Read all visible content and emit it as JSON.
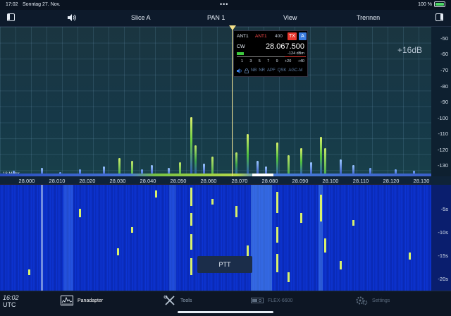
{
  "status_bar": {
    "time": "17:02",
    "date": "Sonntag 27. Nov.",
    "dots": "•••",
    "battery_percent": "100 %",
    "battery_level": 1.0
  },
  "nav": {
    "left_toggle_icon": "sidebar-left-icon",
    "speaker_icon": "speaker-icon",
    "slice": "Slice A",
    "pan": "PAN 1",
    "view": "View",
    "disconnect": "Trennen",
    "right_toggle_icon": "sidebar-right-icon"
  },
  "spectrum": {
    "db_ticks": [
      "-50",
      "-60",
      "-70",
      "-80",
      "-90",
      "-100",
      "-110",
      "-120",
      "-130"
    ],
    "offset_label": "+16dB",
    "band_label": "18 Meter",
    "freq_ticks": [
      "28.000",
      "28.010",
      "28.020",
      "28.030",
      "28.040",
      "28.050",
      "28.060",
      "28.070",
      "28.080",
      "28.090",
      "28.100",
      "28.110",
      "28.120",
      "28.130"
    ]
  },
  "slice_flag": {
    "rx_antenna": "ANT1",
    "tx_antenna": "ANT1",
    "filter_width": "400",
    "tx_badge": "TX",
    "slice_letter": "A",
    "mode": "CW",
    "frequency": "28.067.500",
    "signal_dbm": "-124 dBm",
    "meter_scale": [
      "1",
      "3",
      "5",
      "7",
      "9",
      "+20",
      "+40"
    ],
    "flags": [
      "NB",
      "NR",
      "APF",
      "QSK",
      "AGC-M"
    ],
    "volume_icon": "speaker-icon",
    "lock_icon": "lock-icon"
  },
  "waterfall": {
    "time_ticks": [
      "-5s",
      "-10s",
      "-15s",
      "-20s"
    ],
    "ptt_label": "PTT"
  },
  "tabbar": {
    "clock": "16:02",
    "clock_zone": "UTC",
    "tabs": [
      {
        "label": "Panadapter",
        "icon": "panadapter-icon",
        "active": true
      },
      {
        "label": "Tools",
        "icon": "tools-icon",
        "active": false
      },
      {
        "label": "FLEX-6600",
        "icon": "radio-icon",
        "active": false
      },
      {
        "label": "Settings",
        "icon": "gear-icon",
        "active": false
      }
    ]
  },
  "colors": {
    "accent": "#3b7de0",
    "tx_red": "#e8382f",
    "tuning_line": "#f2e08a",
    "waterfall_signal": "#d8f06a"
  }
}
